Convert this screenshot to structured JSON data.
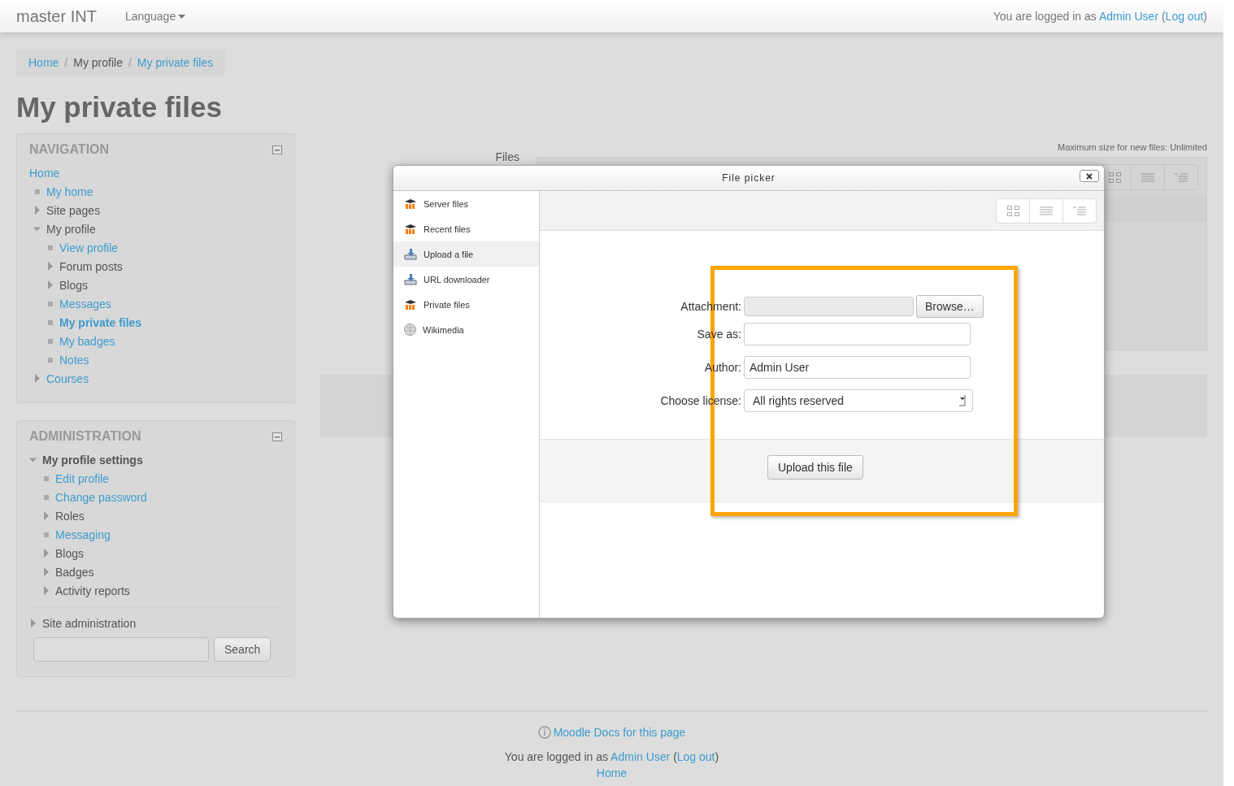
{
  "navbar": {
    "brand": "master INT",
    "language": "Language",
    "login_prefix": "You are logged in as",
    "user": "Admin User",
    "open": "(",
    "logout": "Log out",
    "close": ")"
  },
  "breadcrumb": [
    {
      "label": "Home",
      "link": true
    },
    {
      "separator": "/",
      "label": "My profile",
      "link": false
    },
    {
      "separator": "/",
      "label": "My private files",
      "link": true
    }
  ],
  "page_title": "My private files",
  "navigation": {
    "title": "NAVIGATION",
    "items": [
      {
        "label": "Home",
        "kind": "root",
        "link": true,
        "selected": false,
        "children": [
          {
            "label": "My home",
            "kind": "leaf",
            "link": true,
            "selected": false
          },
          {
            "label": "Site pages",
            "kind": "branch",
            "link": false,
            "expanded": false,
            "selected": false
          },
          {
            "label": "My profile",
            "kind": "branch",
            "link": false,
            "expanded": true,
            "selected": false,
            "children": [
              {
                "label": "View profile",
                "kind": "leaf",
                "link": true,
                "selected": false
              },
              {
                "label": "Forum posts",
                "kind": "branch",
                "link": false,
                "expanded": false,
                "selected": false
              },
              {
                "label": "Blogs",
                "kind": "branch",
                "link": false,
                "expanded": false,
                "selected": false
              },
              {
                "label": "Messages",
                "kind": "leaf",
                "link": true,
                "selected": false
              },
              {
                "label": "My private files",
                "kind": "leaf",
                "link": true,
                "selected": true
              },
              {
                "label": "My badges",
                "kind": "leaf",
                "link": true,
                "selected": false
              },
              {
                "label": "Notes",
                "kind": "leaf",
                "link": true,
                "selected": false
              }
            ]
          },
          {
            "label": "Courses",
            "kind": "branch",
            "link": true,
            "expanded": false,
            "selected": false
          }
        ]
      }
    ]
  },
  "administration": {
    "title": "ADMINISTRATION",
    "items": [
      {
        "label": "My profile settings",
        "kind": "section",
        "link": false,
        "expanded": true,
        "selected": false,
        "children": [
          {
            "label": "Edit profile",
            "kind": "leaf",
            "link": true,
            "selected": false
          },
          {
            "label": "Change password",
            "kind": "leaf",
            "link": true,
            "selected": false
          },
          {
            "label": "Roles",
            "kind": "branch",
            "link": false,
            "expanded": false,
            "selected": false
          },
          {
            "label": "Messaging",
            "kind": "leaf",
            "link": true,
            "selected": false
          },
          {
            "label": "Blogs",
            "kind": "branch",
            "link": false,
            "expanded": false,
            "selected": false
          },
          {
            "label": "Badges",
            "kind": "branch",
            "link": false,
            "expanded": false,
            "selected": false
          },
          {
            "label": "Activity reports",
            "kind": "branch",
            "link": false,
            "expanded": false,
            "selected": false
          }
        ]
      },
      {
        "label": "Site administration",
        "kind": "branch",
        "link": false,
        "expanded": false,
        "selected": false,
        "divider": true
      }
    ],
    "search_button": "Search"
  },
  "files": {
    "label": "Files",
    "max_size": "Maximum size for new files: Unlimited"
  },
  "file_picker": {
    "title": "File picker",
    "repositories": [
      {
        "label": "Server files",
        "kind": "moodle",
        "selected": false
      },
      {
        "label": "Recent files",
        "kind": "moodle",
        "selected": false
      },
      {
        "label": "Upload a file",
        "kind": "upload",
        "selected": true
      },
      {
        "label": "URL downloader",
        "kind": "upload",
        "selected": false
      },
      {
        "label": "Private files",
        "kind": "moodle",
        "selected": false
      },
      {
        "label": "Wikimedia",
        "kind": "wiki",
        "selected": false
      }
    ],
    "fields": [
      {
        "label": "Attachment:",
        "kind": "file",
        "button": "Browse…"
      },
      {
        "label": "Save as:",
        "kind": "text"
      },
      {
        "label": "Author:",
        "kind": "text",
        "value": "Admin User"
      },
      {
        "label": "Choose license:",
        "kind": "select",
        "value": "All rights reserved"
      }
    ],
    "submit": "Upload this file",
    "highlighted": true
  },
  "footer": {
    "docs_link": "Moodle Docs for this page",
    "login_prefix": "You are logged in as",
    "user": "Admin User",
    "open": "(",
    "logout": "Log out",
    "close": ")",
    "home": "Home"
  }
}
